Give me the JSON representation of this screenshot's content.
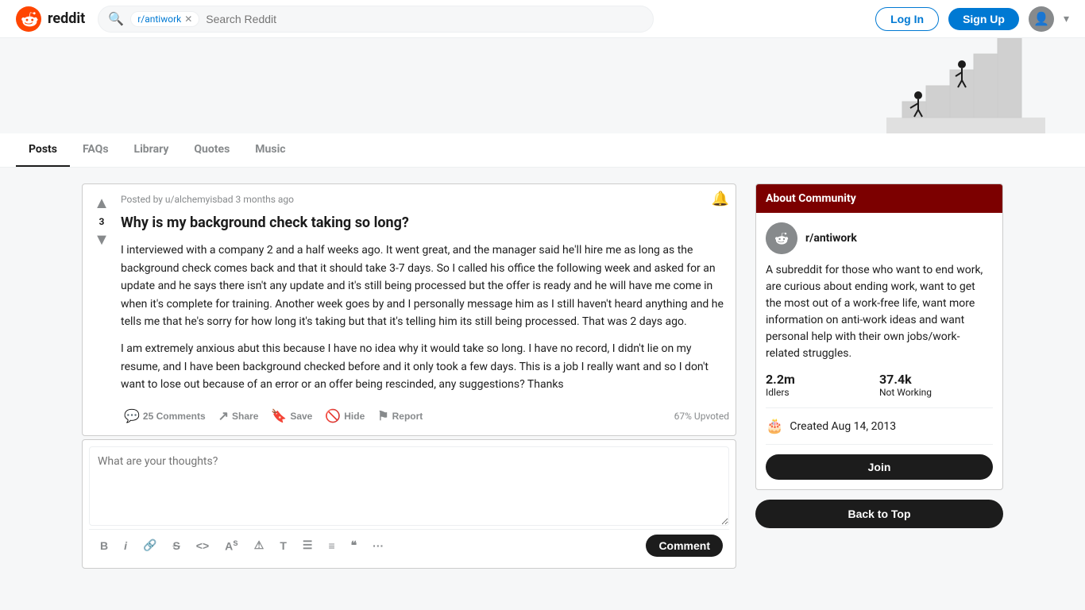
{
  "header": {
    "logo_text": "reddit",
    "search_placeholder": "Search Reddit",
    "search_tag": "r/antiwork",
    "login_label": "Log In",
    "signup_label": "Sign Up"
  },
  "nav": {
    "tabs": [
      {
        "label": "Posts",
        "active": true
      },
      {
        "label": "FAQs",
        "active": false
      },
      {
        "label": "Library",
        "active": false
      },
      {
        "label": "Quotes",
        "active": false
      },
      {
        "label": "Music",
        "active": false
      }
    ]
  },
  "post": {
    "meta": "Posted by u/alchemyisbad 3 months ago",
    "title": "Why is my background check taking so long?",
    "body_p1": "I interviewed with a company 2 and a half weeks ago. It went great, and the manager said he'll hire me as long as the background check comes back and that it should take 3-7 days. So I called his office the following week and asked for an update and he says there isn't any update and it's still being processed but the offer is ready and he will have me come in when it's complete for training. Another week goes by and I personally message him as I still haven't heard anything and he tells me that he's sorry for how long it's taking but that it's telling him its still being processed. That was 2 days ago.",
    "body_p2": "I am extremely anxious abut this because I have no idea why it would take so long. I have no record, I didn't lie on my resume, and I have been background checked before and it only took a few days. This is a job I really want and so I don't want to lose out because of an error or an offer being rescinded, any suggestions? Thanks",
    "vote_count": "3",
    "comments_label": "25 Comments",
    "share_label": "Share",
    "save_label": "Save",
    "hide_label": "Hide",
    "report_label": "Report",
    "upvoted_pct": "67% Upvoted"
  },
  "comment_box": {
    "placeholder": "What are your thoughts?",
    "submit_label": "Comment",
    "toolbar": {
      "bold": "B",
      "italic": "i",
      "link": "🔗",
      "strikethrough": "S",
      "code_inline": "<>",
      "superscript": "A",
      "spoiler": "⚠",
      "heading": "T",
      "list_bullet": "≡",
      "list_number": "≡",
      "blockquote": "❝",
      "more": "···"
    }
  },
  "sidebar": {
    "about_header": "About Community",
    "community_name": "r/antiwork",
    "community_desc": "A subreddit for those who want to end work, are curious about ending work, want to get the most out of a work-free life, want more information on anti-work ideas and want personal help with their own jobs/work-related struggles.",
    "members_value": "2.2m",
    "members_label": "Idlers",
    "online_value": "37.4k",
    "online_label": "Not Working",
    "created_label": "Created Aug 14, 2013",
    "join_label": "Join",
    "back_to_top": "Back to Top"
  }
}
